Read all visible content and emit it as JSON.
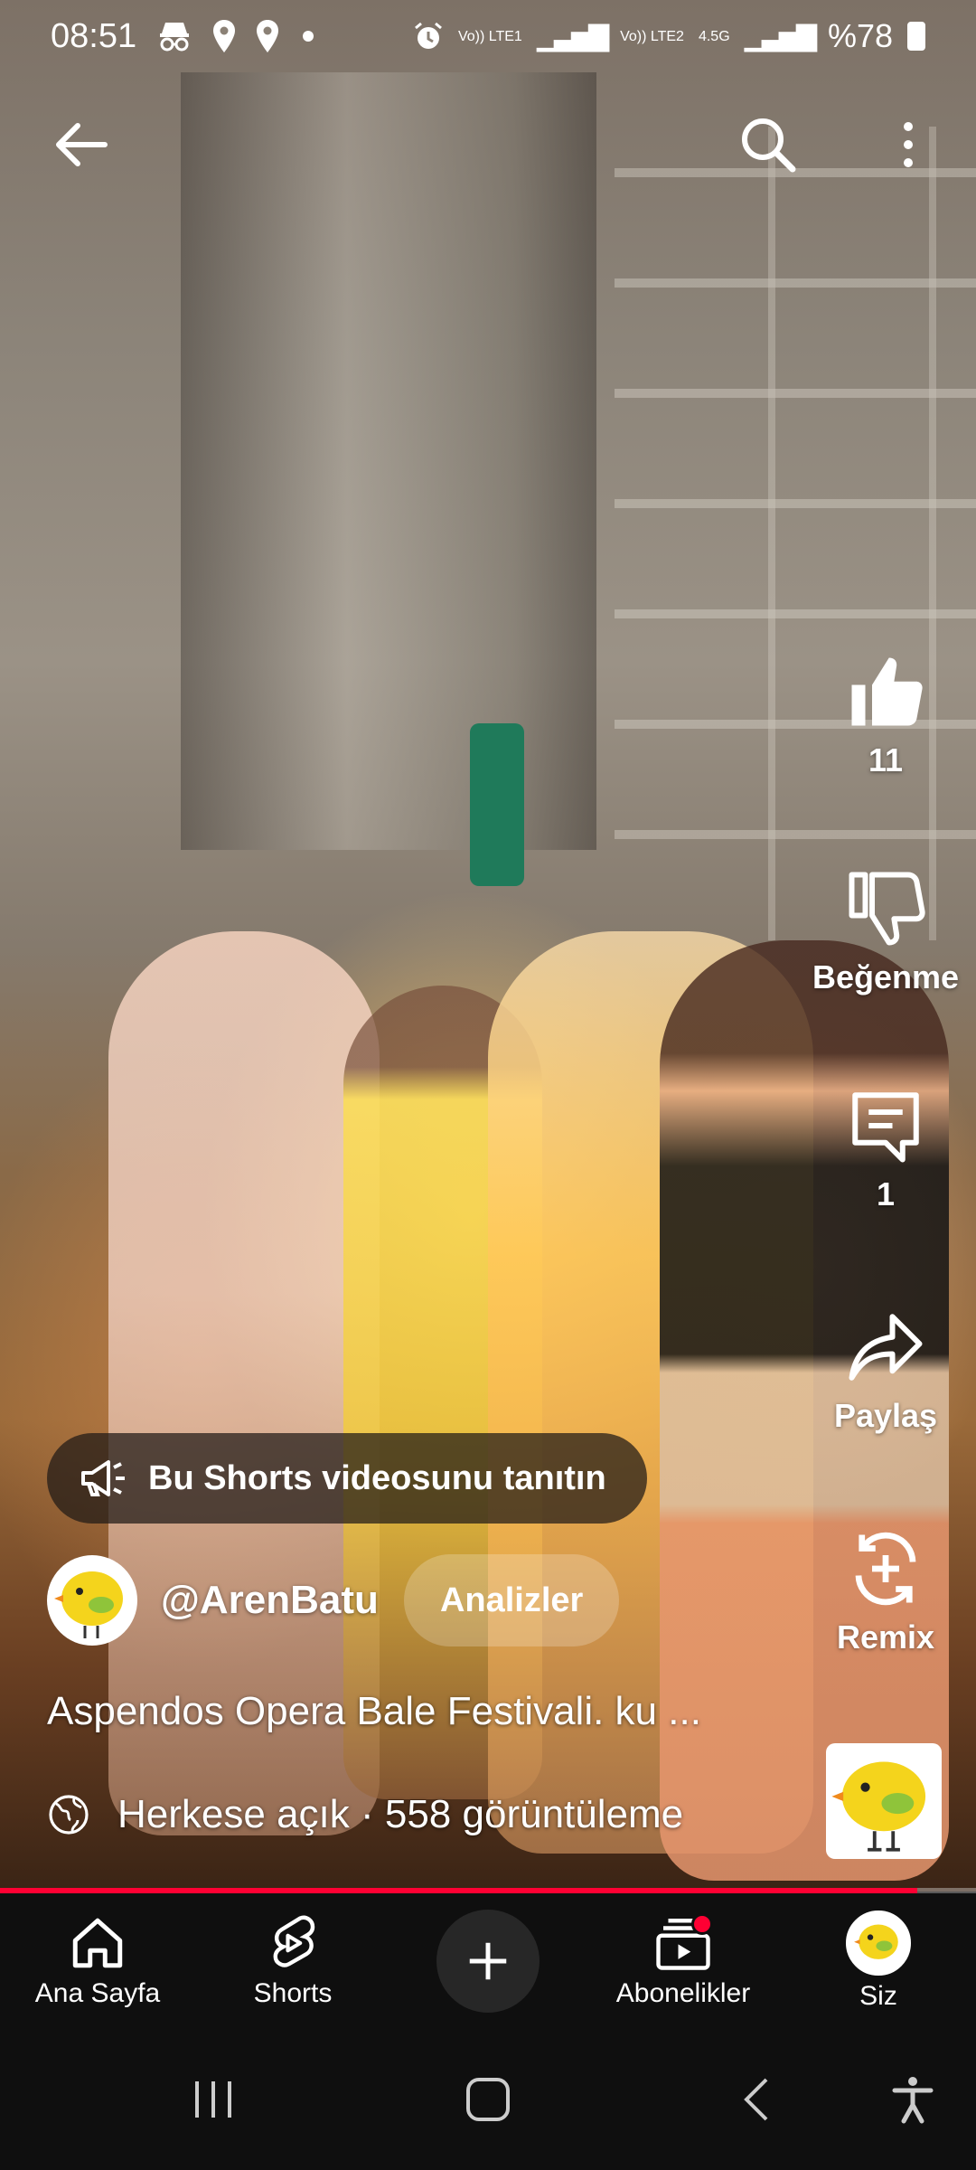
{
  "status_bar": {
    "time": "08:51",
    "sim1_label": "Vo)) LTE1",
    "sim2_label": "Vo)) LTE2",
    "net_type": "4.5G",
    "battery_text": "%78",
    "left_icons": [
      "incognito-icon",
      "location-icon",
      "location-icon",
      "dot-icon"
    ],
    "right_icons": [
      "alarm-icon",
      "signal-icon",
      "signal-icon",
      "battery-icon"
    ]
  },
  "top_bar": {
    "icons": [
      "back-arrow-icon",
      "search-icon",
      "more-vert-icon"
    ]
  },
  "actions": {
    "like_count": "11",
    "dislike_label": "Beğenme",
    "comment_count": "1",
    "share_label": "Paylaş",
    "remix_label": "Remix"
  },
  "promote": {
    "label": "Bu Shorts videosunu tanıtın"
  },
  "channel": {
    "handle": "@ArenBatu",
    "analytics_label": "Analizler"
  },
  "video": {
    "caption": "Aspendos Opera Bale Festivali.  ku ...",
    "visibility_views": "Herkese açık · 558 görüntüleme",
    "progress": 0.94
  },
  "bottom_nav": {
    "items": [
      {
        "label": "Ana Sayfa",
        "icon": "home-icon"
      },
      {
        "label": "Shorts",
        "icon": "shorts-icon"
      },
      {
        "label": "",
        "icon": "plus-icon"
      },
      {
        "label": "Abonelikler",
        "icon": "subscriptions-icon"
      },
      {
        "label": "Siz",
        "icon": "avatar-icon"
      }
    ]
  },
  "colors": {
    "accent_red": "#ff0033",
    "nav_bg": "#0f0f0f"
  }
}
